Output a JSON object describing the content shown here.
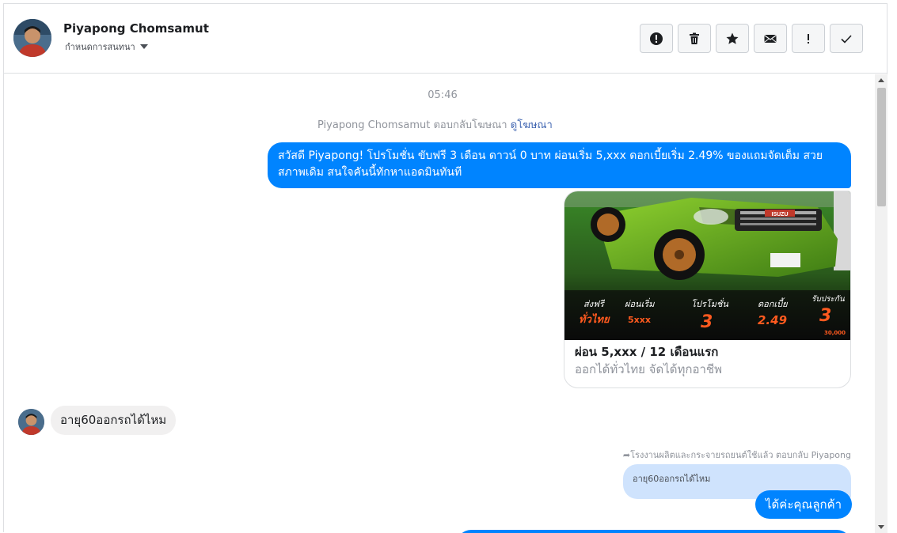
{
  "header": {
    "contact_name": "Piyapong Chomsamut",
    "assign_label": "กำหนดการสนทนา",
    "toolbar": [
      {
        "icon": "alert-circle-icon",
        "name": "spam-button"
      },
      {
        "icon": "trash-icon",
        "name": "delete-button"
      },
      {
        "icon": "star-icon",
        "name": "star-button"
      },
      {
        "icon": "envelope-icon",
        "name": "mark-unread-button"
      },
      {
        "icon": "exclamation-icon",
        "name": "follow-up-button"
      },
      {
        "icon": "check-icon",
        "name": "mark-done-button"
      }
    ]
  },
  "chat": {
    "timestamp": "05:46",
    "system_note": "Piyapong Chomsamut ตอบกลับโฆษณา",
    "system_link": "ดูโฆษณา",
    "outgoing_message": "สวัสดี Piyapong! โปรโมชั่น ขับฟรี 3 เดือน ดาวน์ 0 บาท ผ่อนเริ่ม 5,xxx  ดอกเบี้ยเริ่ม 2.49% ของแถมจัดเต็ม สวยสภาพเดิม สนใจคันนี้ทักหาแอดมินทันที",
    "ad_card": {
      "title": "ผ่อน 5,xxx / 12 เดือนแรก",
      "subtitle": "ออกได้ทั่วไทย จัดได้ทุกอาชีพ",
      "image_texts": {
        "brand": "ISUZU",
        "shipping_top": "ส่งฟรี",
        "shipping_bottom": "ทั่วไทย",
        "installment_top": "ผ่อนเริ่ม",
        "installment_value": "5xxx",
        "promo_top": "โปรโมชั่น",
        "promo_value": "3",
        "interest_top": "ดอกเบี้ย",
        "interest_value": "2.49",
        "warranty_top": "รับประกัน",
        "warranty_value": "3",
        "warranty_sub": "30,000"
      }
    },
    "incoming_message": "อายุ60ออกรถได้ไหม",
    "reply_meta": "โรงงานผลิตและกระจายรถยนต์ใช้แล้ว ตอบกลับ Piyapong",
    "quoted_text": "อายุ60ออกรถได้ไหม",
    "reply_message": "ได้ค่ะคุณลูกค้า"
  },
  "colors": {
    "accent": "#0084ff",
    "incoming_bubble": "#f1f0f0",
    "quoted_bubble": "#cfe3fd",
    "link": "#4267b2"
  }
}
